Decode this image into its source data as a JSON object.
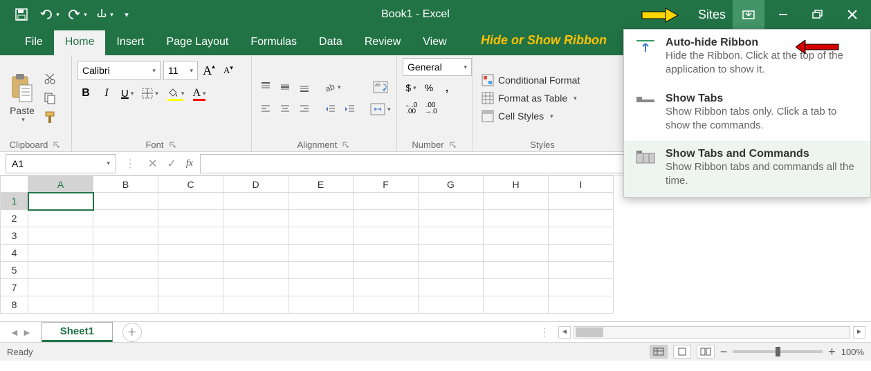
{
  "title": "Book1 - Excel",
  "sites": "Sites",
  "qat": {
    "touch_mode": "Touch/Mouse Mode"
  },
  "tabs": {
    "file": "File",
    "home": "Home",
    "insert": "Insert",
    "page_layout": "Page Layout",
    "formulas": "Formulas",
    "data": "Data",
    "review": "Review",
    "view": "View"
  },
  "annotation": "Hide or Show Ribbon",
  "ribbon": {
    "clipboard": {
      "label": "Clipboard",
      "paste": "Paste"
    },
    "font": {
      "label": "Font",
      "name": "Calibri",
      "size": "11",
      "grow": "A",
      "shrink": "A",
      "bold": "B",
      "italic": "I",
      "underline": "U"
    },
    "alignment": {
      "label": "Alignment"
    },
    "number": {
      "label": "Number",
      "format": "General",
      "currency": "$",
      "percent": "%",
      "comma": ",",
      "inc": ".0",
      "inc2": ".00",
      "dec": ".00",
      "dec2": ".0"
    },
    "styles": {
      "label": "Styles",
      "cond": "Conditional Format",
      "table": "Format as Table",
      "cell": "Cell Styles"
    }
  },
  "namebox": "A1",
  "fx": "fx",
  "columns": [
    "A",
    "B",
    "C",
    "D",
    "E",
    "F",
    "G",
    "H",
    "I"
  ],
  "rows": [
    "1",
    "2",
    "3",
    "4",
    "5",
    "7",
    "8"
  ],
  "sheet": "Sheet1",
  "status": "Ready",
  "zoom": "100%",
  "menu": {
    "opt1": {
      "title": "Auto-hide Ribbon",
      "desc": "Hide the Ribbon. Click at the top of the application to show it."
    },
    "opt2": {
      "title": "Show Tabs",
      "desc": "Show Ribbon tabs only. Click a tab to show the commands."
    },
    "opt3": {
      "title": "Show Tabs and Commands",
      "desc": "Show Ribbon tabs and commands all the time."
    }
  }
}
